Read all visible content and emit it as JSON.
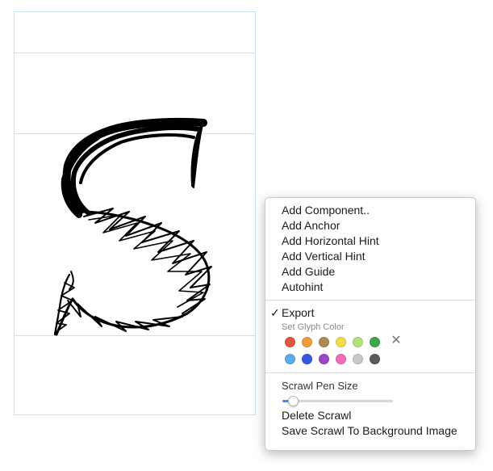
{
  "menu": {
    "items_top": [
      {
        "label": "Add Component.."
      },
      {
        "label": "Add Anchor"
      },
      {
        "label": "Add Horizontal Hint"
      },
      {
        "label": "Add Vertical Hint"
      },
      {
        "label": "Add Guide"
      },
      {
        "label": "Autohint"
      }
    ],
    "export": {
      "label": "Export",
      "checked": true,
      "check_mark": "✓"
    },
    "glyph_color_header": "Set Glyph Color",
    "glyph_colors_row1": [
      "#e0563d",
      "#f39a3c",
      "#b08a55",
      "#f0dc4a",
      "#b3e07a",
      "#3ea74a"
    ],
    "glyph_colors_row2": [
      "#5aafea",
      "#3a56e0",
      "#9b45c8",
      "#ef6fb6",
      "#c9c9c9",
      "#5a5a5a"
    ],
    "clear_color_icon": "close-icon",
    "pen_size_label": "Scrawl Pen Size",
    "pen_size_value": 0.06,
    "items_bottom": [
      {
        "label": "Delete Scrawl"
      },
      {
        "label": "Save Scrawl To Background Image"
      }
    ]
  },
  "canvas": {
    "glyph": "S",
    "guide_color": "#bfe4ea"
  }
}
